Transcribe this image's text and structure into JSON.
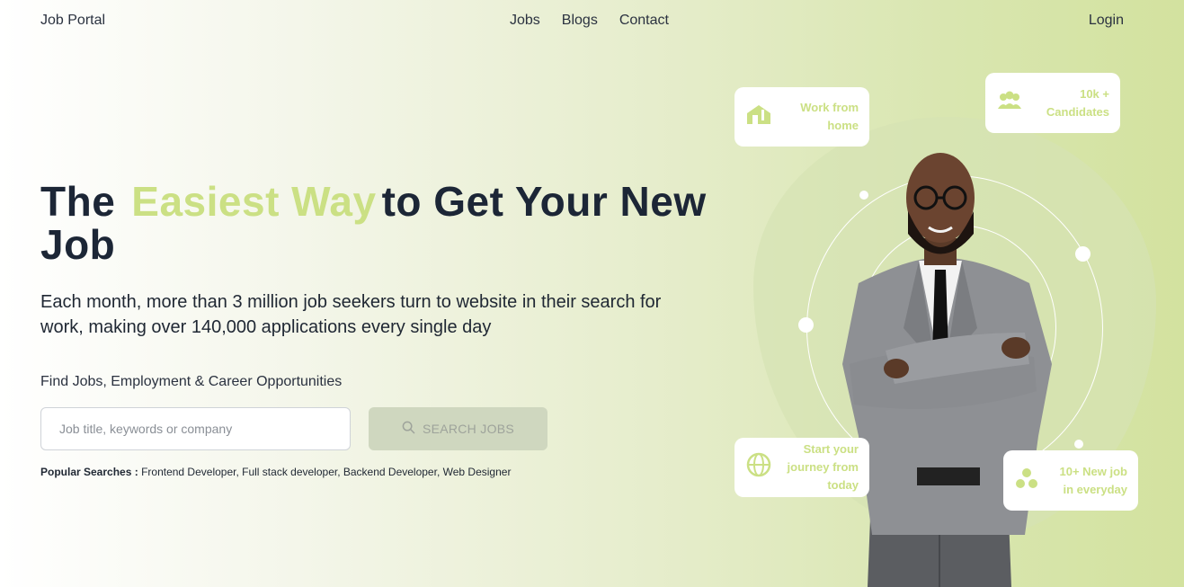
{
  "nav": {
    "brand": "Job Portal",
    "links": [
      "Jobs",
      "Blogs",
      "Contact"
    ],
    "login": "Login"
  },
  "hero": {
    "headline_start": "The",
    "headline_accent": "Easiest Way",
    "headline_end": "to Get Your New Job",
    "subtitle": "Each month, more than 3 million job seekers turn to website in their search for work, making over 140,000 applications every single day",
    "find_label": "Find Jobs, Employment & Career Opportunities",
    "search_placeholder": "Job title, keywords or company",
    "search_button": "SEARCH JOBS",
    "popular_label": "Popular Searches :",
    "popular_items": [
      "Frontend Developer",
      "Full stack developer",
      "Backend Developer",
      "Web Designer"
    ]
  },
  "cards": {
    "work_from_home": "Work from home",
    "candidates": "10k + Candidates",
    "journey": "Start your journey from today",
    "new_jobs": "10+ New job in everyday"
  },
  "colors": {
    "accent": "#cbe084",
    "text": "#1c2636",
    "button_bg": "#cfd7bf"
  },
  "icons": [
    "house-icon",
    "people-icon",
    "globe-icon",
    "circles-icon",
    "search-icon"
  ]
}
